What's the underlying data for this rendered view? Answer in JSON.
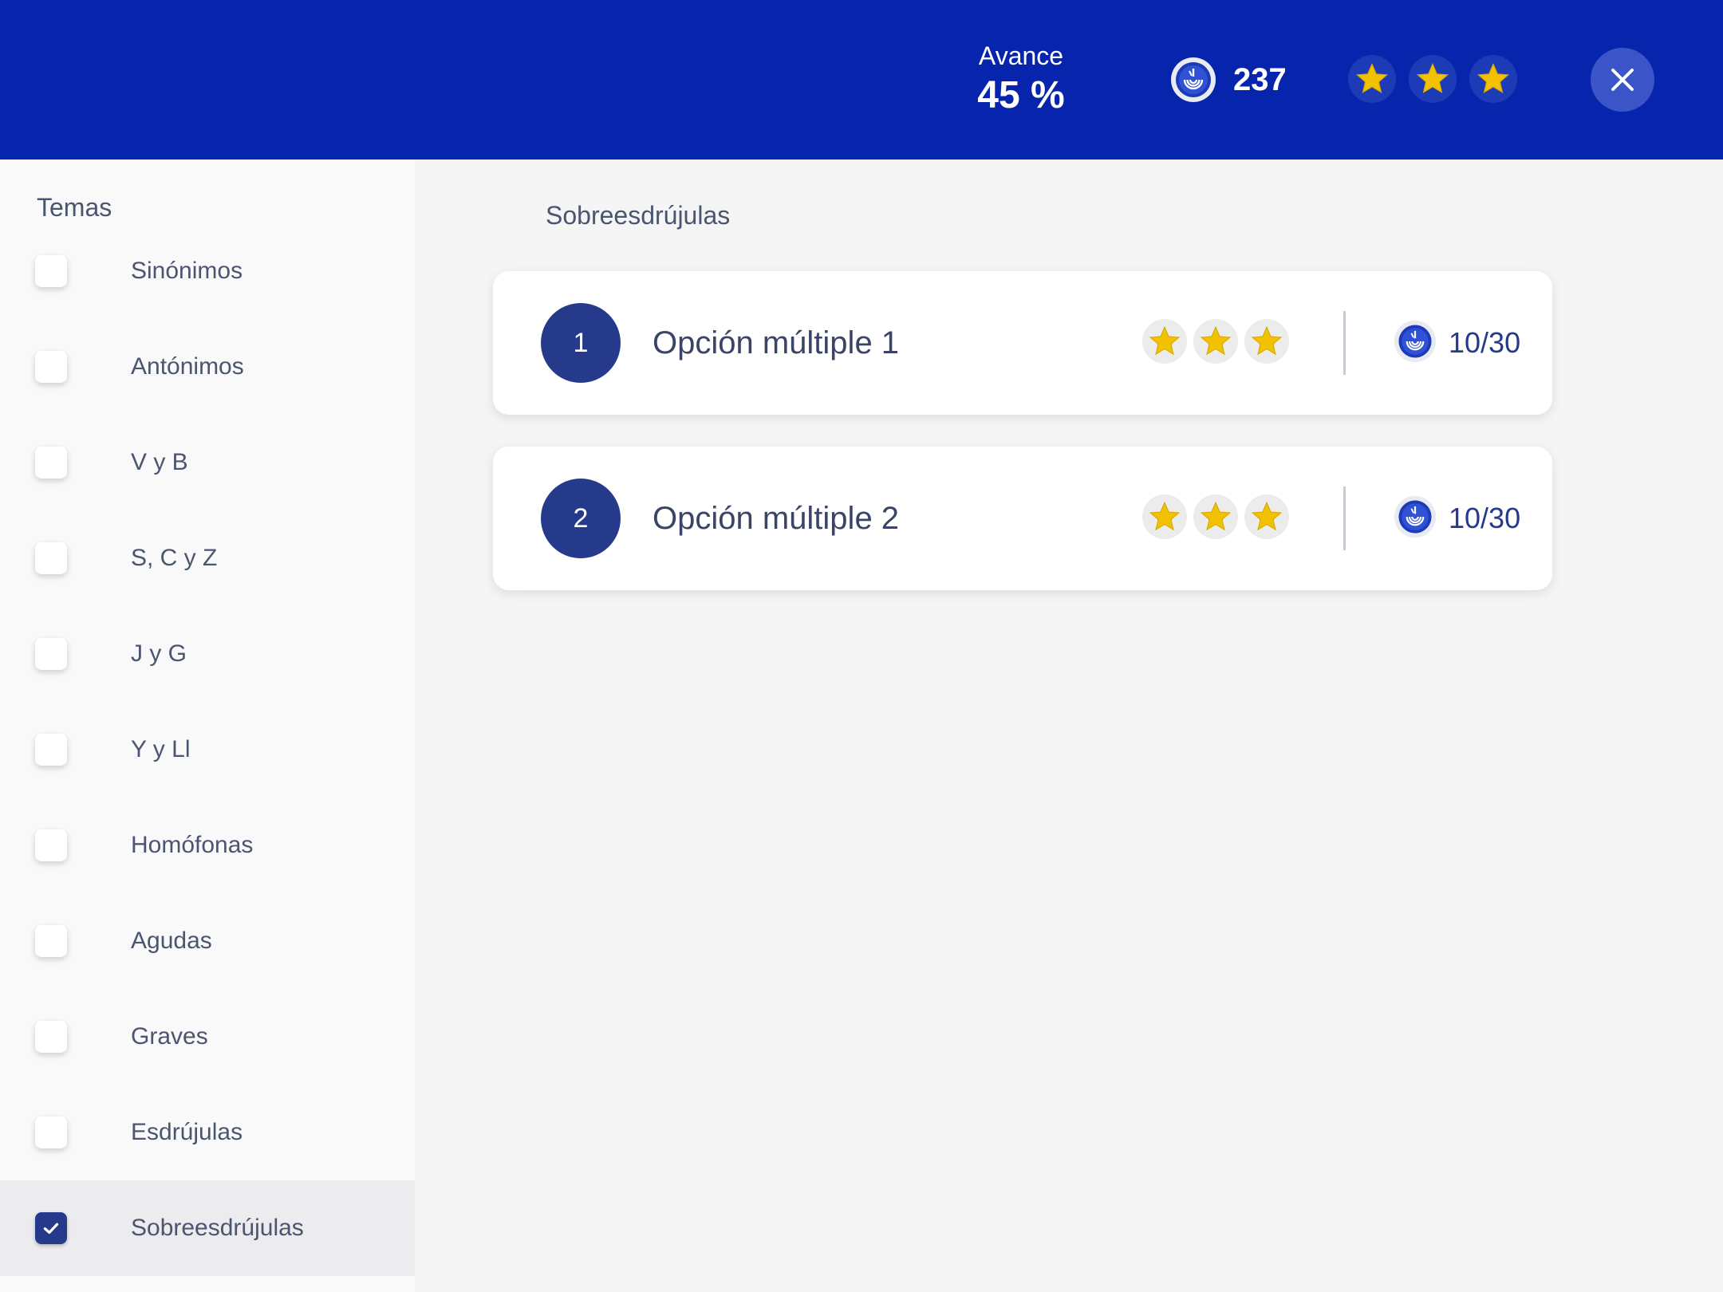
{
  "header": {
    "progress_label": "Avance",
    "progress_value": "45 %",
    "coins": "237",
    "stars": [
      "star",
      "star",
      "star"
    ],
    "close_icon": "close-icon",
    "colors": {
      "background": "#0725ac",
      "star": "#f2c200"
    }
  },
  "sidebar": {
    "title": "Temas",
    "topics": [
      {
        "label": "Sinónimos",
        "checked": false
      },
      {
        "label": "Antónimos",
        "checked": false
      },
      {
        "label": "V y B",
        "checked": false
      },
      {
        "label": "S, C y Z",
        "checked": false
      },
      {
        "label": "J y G",
        "checked": false
      },
      {
        "label": "Y y Ll",
        "checked": false
      },
      {
        "label": "Homófonas",
        "checked": false
      },
      {
        "label": "Agudas",
        "checked": false
      },
      {
        "label": "Graves",
        "checked": false
      },
      {
        "label": "Esdrújulas",
        "checked": false
      },
      {
        "label": "Sobreesdrújulas",
        "checked": true
      }
    ]
  },
  "main": {
    "section_title": "Sobreesdrújulas",
    "activities": [
      {
        "number": "1",
        "title": "Opción múltiple 1",
        "stars": 3,
        "score": "10/30"
      },
      {
        "number": "2",
        "title": "Opción múltiple 2",
        "stars": 3,
        "score": "10/30"
      }
    ]
  }
}
